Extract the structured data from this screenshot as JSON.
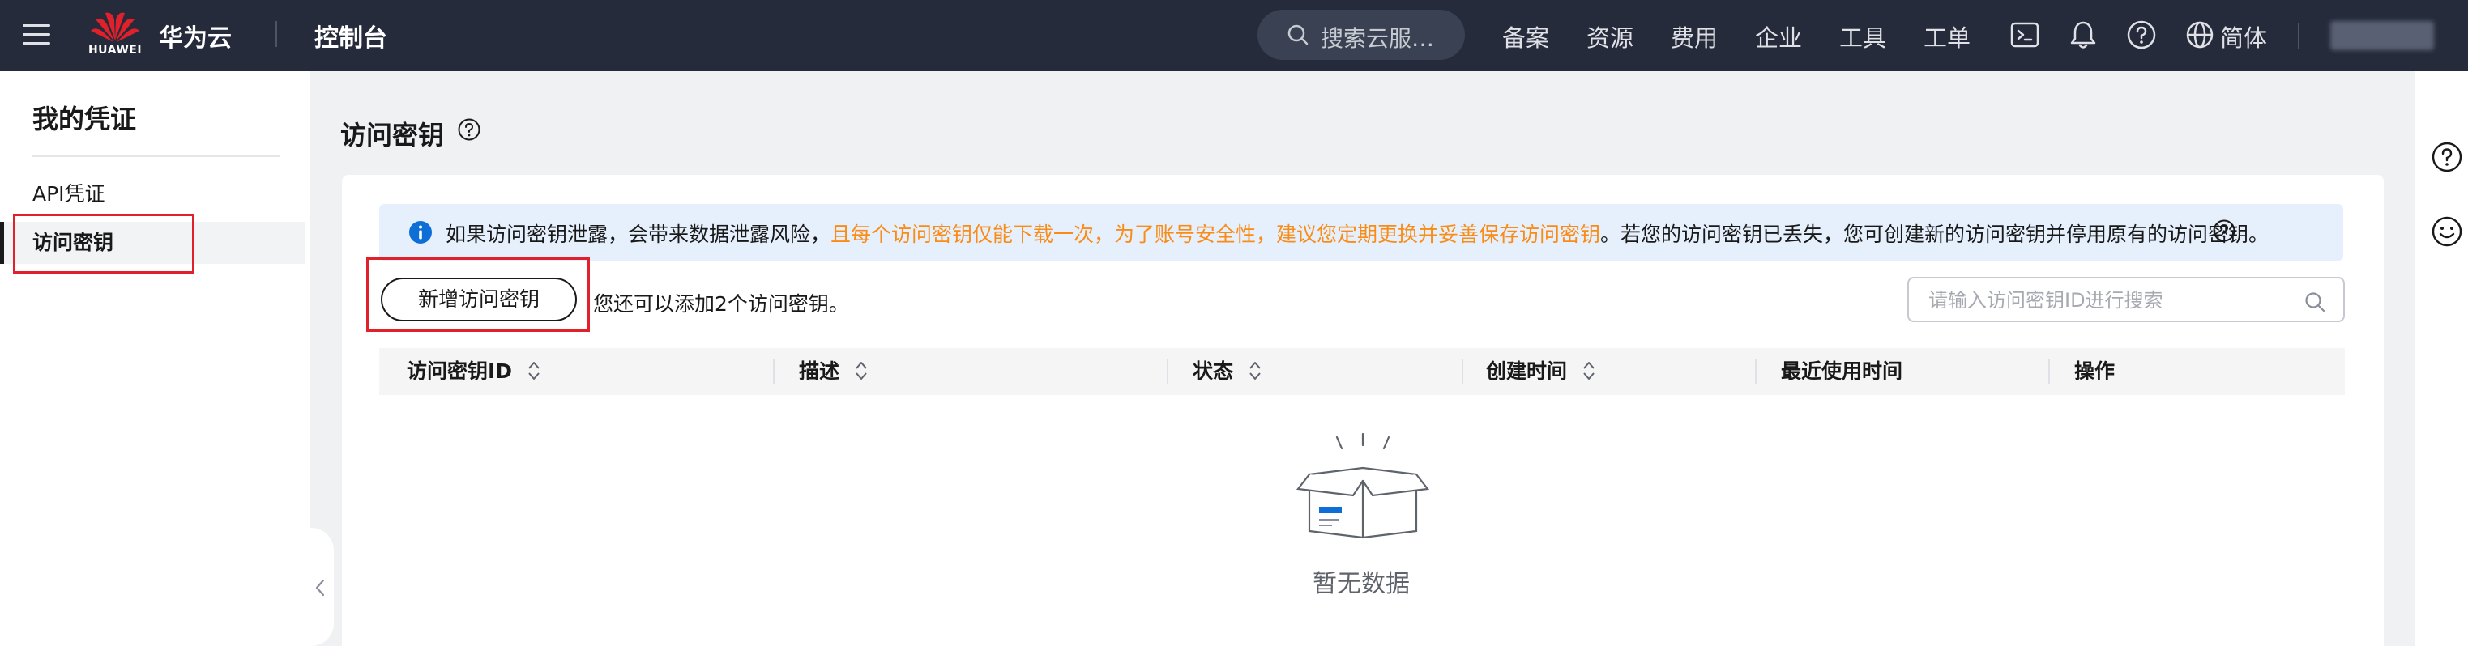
{
  "topbar": {
    "logo_text": "HUAWEI",
    "brand": "华为云",
    "console": "控制台",
    "search_placeholder": "搜索云服…",
    "nav": [
      "备案",
      "资源",
      "费用",
      "企业",
      "工具",
      "工单"
    ],
    "language": "简体",
    "icons": [
      "terminal-icon",
      "bell-icon",
      "help-icon",
      "globe-icon"
    ]
  },
  "sidebar": {
    "title": "我的凭证",
    "items": [
      {
        "label": "API凭证",
        "active": false
      },
      {
        "label": "访问密钥",
        "active": true
      }
    ]
  },
  "main": {
    "title": "访问密钥",
    "alert": {
      "text_before": "如果访问密钥泄露，会带来数据泄露风险，",
      "text_warning": "且每个访问密钥仅能下载一次，为了账号安全性，建议您定期更换并妥善保存访问密钥",
      "text_after": "。若您的访问密钥已丢失，您可创建新的访问密钥并停用原有的访问密钥。"
    },
    "add_button": "新增访问密钥",
    "add_hint": "您还可以添加2个访问密钥。",
    "search_placeholder": "请输入访问密钥ID进行搜索",
    "table": {
      "columns": [
        "访问密钥ID",
        "描述",
        "状态",
        "创建时间",
        "最近使用时间",
        "操作"
      ],
      "rows": []
    },
    "empty_text": "暂无数据"
  },
  "colors": {
    "topbar_bg": "#252b3a",
    "warning": "#fa8c16",
    "info": "#0d6ed6",
    "highlight_box": "#e0212b"
  }
}
